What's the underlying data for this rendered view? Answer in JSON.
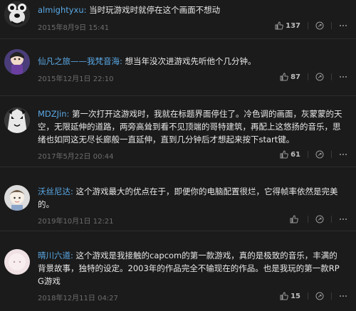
{
  "comments": [
    {
      "user": "almightyxu:",
      "text": "当时玩游戏时就停在这个画面不想动",
      "time": "2015年8月9日 15:41",
      "likes": "137",
      "avatar_color": "#2a2a2a"
    },
    {
      "user": "仙凡之旅——我梵音海:",
      "text": "想当年没次进游戏先听他个几分钟。",
      "time": "2015年12月1日 22:10",
      "likes": "87",
      "avatar_color": "#3b2f63"
    },
    {
      "user": "MDZJin:",
      "text": "第一次打开这游戏时，我就在标题界面停住了。冷色调的画面，灰蒙蒙的天空，无限延伸的道路，两旁高耸到看不见顶端的哥特建筑，再配上这悠扬的音乐，思绪也如同这无尽长廊般一直延伸，直到几分钟后才想起来按下start键。",
      "time": "2017年5月22日 00:44",
      "likes": "61",
      "avatar_color": "#2d2d2d"
    },
    {
      "user": "沃丝尼达:",
      "text": "这个游戏最大的优点在于，即便你的电脑配置很烂，它得帧率依然是完美的。",
      "time": "2019年10月1日 12:21",
      "likes": "",
      "avatar_color": "#dcdcdc"
    },
    {
      "user": "晴川六道:",
      "text": "这个游戏是我接触的capcom的第一款游戏，真的是极致的音乐，丰满的背景故事，独特的设定。2003年的作品完全不输现在的作品。也是我玩的第一款RPG游戏",
      "time": "2018年12月11日 04:27",
      "likes": "15",
      "avatar_color": "#e9d9dc"
    }
  ],
  "icons": {
    "like": "thumbs-up-icon",
    "share": "share-icon",
    "more": "more-icon"
  }
}
